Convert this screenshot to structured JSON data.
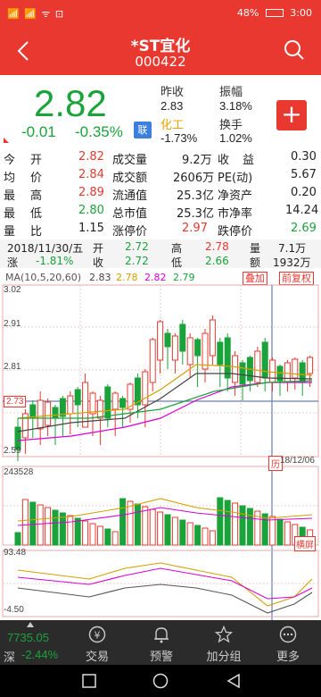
{
  "status_bar": {
    "signal": "📶 📶 ᯤ ⊡",
    "battery": "48%",
    "time": "3:00"
  },
  "header": {
    "name": "*ST宜化",
    "code": "000422"
  },
  "quote": {
    "price": "2.82",
    "change": "-0.01",
    "change_pct": "-0.35%",
    "lian_badge": "联",
    "prev_close_label": "昨收",
    "prev_close": "2.83",
    "amplitude_label": "振幅",
    "amplitude": "3.18%",
    "sector_label": "化工",
    "sector_pct": "-1.73%",
    "turnover_label": "换手",
    "turnover": "1.02%",
    "add_label": "+"
  },
  "stats": [
    [
      [
        "今",
        "开",
        "2.82"
      ],
      [
        "成交量",
        "9.2万"
      ],
      [
        "收",
        "益",
        "0.30"
      ]
    ],
    [
      [
        "均",
        "价",
        "2.84"
      ],
      [
        "成交额",
        "2606万"
      ],
      [
        "PE(动)",
        "",
        "5.67"
      ]
    ],
    [
      [
        "最",
        "高",
        "2.89"
      ],
      [
        "流通值",
        "25.3亿"
      ],
      [
        "净资产",
        "",
        "0.20"
      ]
    ],
    [
      [
        "最",
        "低",
        "2.80"
      ],
      [
        "总市值",
        "25.3亿"
      ],
      [
        "市净率",
        "",
        "14.24"
      ]
    ],
    [
      [
        "量",
        "比",
        "1.15"
      ],
      [
        "涨停价",
        "2.97"
      ],
      [
        "跌停价",
        "",
        "2.69"
      ]
    ]
  ],
  "date_row": {
    "date": "2018/11/30/五",
    "open_label": "开",
    "open": "2.72",
    "high_label": "高",
    "high": "2.78",
    "vol_label": "量",
    "vol": "7.1万",
    "chg_label": "涨",
    "chg": "-1.81%",
    "close_label": "收",
    "close": "2.72",
    "low_label": "低",
    "low": "2.66",
    "amt_label": "额",
    "amt": "1932万"
  },
  "ma": {
    "label": "MA(10,5,20,60)",
    "values": [
      "2.83",
      "2.78",
      "2.82",
      "2.79"
    ],
    "overlay_button": "叠加",
    "adjust_button": "前复权"
  },
  "chart_data": {
    "type": "candlestick",
    "ylim": [
      2.59,
      3.02
    ],
    "y_ticks": [
      "3.02",
      "2.91",
      "2.81",
      "2.73",
      "2.59"
    ],
    "date_label": "18/12/06",
    "history_tag": "历",
    "volume_top": "243528",
    "volume_button": "横屏",
    "macd_top": "93.48",
    "macd_bottom": "-4.50"
  },
  "bottom_nav": {
    "index_value": "7735.05",
    "index_name": "深",
    "index_pct": "-2.44%",
    "items": [
      {
        "label": "交易",
        "icon": "yen-icon"
      },
      {
        "label": "预警",
        "icon": "bell-icon"
      },
      {
        "label": "加分组",
        "icon": "star-icon"
      },
      {
        "label": "更多",
        "icon": "more-icon"
      }
    ]
  },
  "colors": {
    "up": "#e8382f",
    "down": "#1aa33a",
    "accent": "#e8382f"
  }
}
